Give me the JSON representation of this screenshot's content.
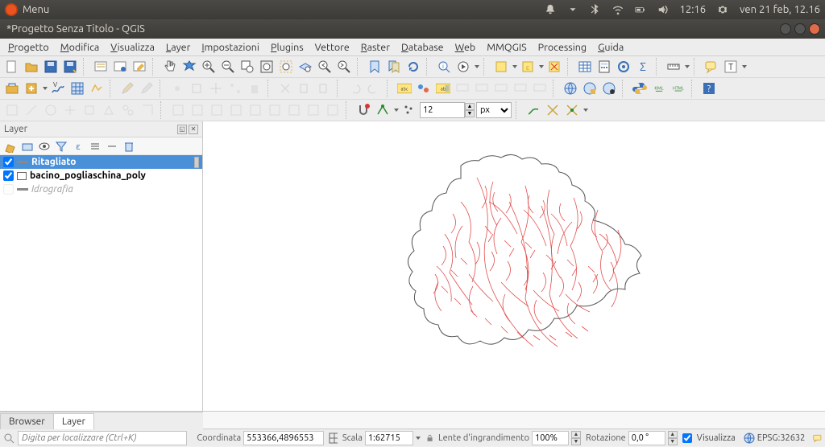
{
  "os_bar": {
    "menu_label": "Menu",
    "time": "12:16",
    "date": "ven 21 feb, 12.16"
  },
  "window": {
    "title": "*Progetto Senza Titolo - QGIS"
  },
  "menubar": [
    {
      "u": "P",
      "rest": "rogetto"
    },
    {
      "u": "M",
      "rest": "odifica"
    },
    {
      "u": "V",
      "rest": "isualizza"
    },
    {
      "u": "L",
      "rest": "ayer"
    },
    {
      "u": "I",
      "rest": "mpostazioni"
    },
    {
      "u": "P",
      "rest": "lugins"
    },
    {
      "u": "",
      "rest": "Vettore"
    },
    {
      "u": "R",
      "rest": "aster"
    },
    {
      "u": "D",
      "rest": "atabase"
    },
    {
      "u": "W",
      "rest": "eb"
    },
    {
      "u": "",
      "rest": "MMQGIS"
    },
    {
      "u": "",
      "rest": "Processing"
    },
    {
      "u": "G",
      "rest": "uida"
    }
  ],
  "panel": {
    "title": "Layer"
  },
  "layers": [
    {
      "checked": true,
      "name": "Ritagliato",
      "selected": true,
      "bold": true,
      "style": "line"
    },
    {
      "checked": true,
      "name": "bacino_pogliaschina_poly",
      "selected": false,
      "bold": true,
      "style": "poly"
    },
    {
      "checked": false,
      "name": "Idrografia",
      "selected": false,
      "bold": false,
      "dim": true,
      "style": "line"
    }
  ],
  "bottom_tabs": {
    "browser": "Browser",
    "layer": "Layer"
  },
  "toolbar3": {
    "spin_value": "12",
    "unit": "px"
  },
  "statusbar": {
    "locator_placeholder": "Digita per localizzare (Ctrl+K)",
    "coord_label": "Coordinata",
    "coord_value": "553366,4896553",
    "scale_label": "Scala",
    "scale_value": "1:62715",
    "magnifier_label": "Lente d'ingrandimento",
    "magnifier_value": "100%",
    "rotation_label": "Rotazione",
    "rotation_value": "0,0 °",
    "render_label": "Visualizza",
    "crs_label": "EPSG:32632"
  }
}
